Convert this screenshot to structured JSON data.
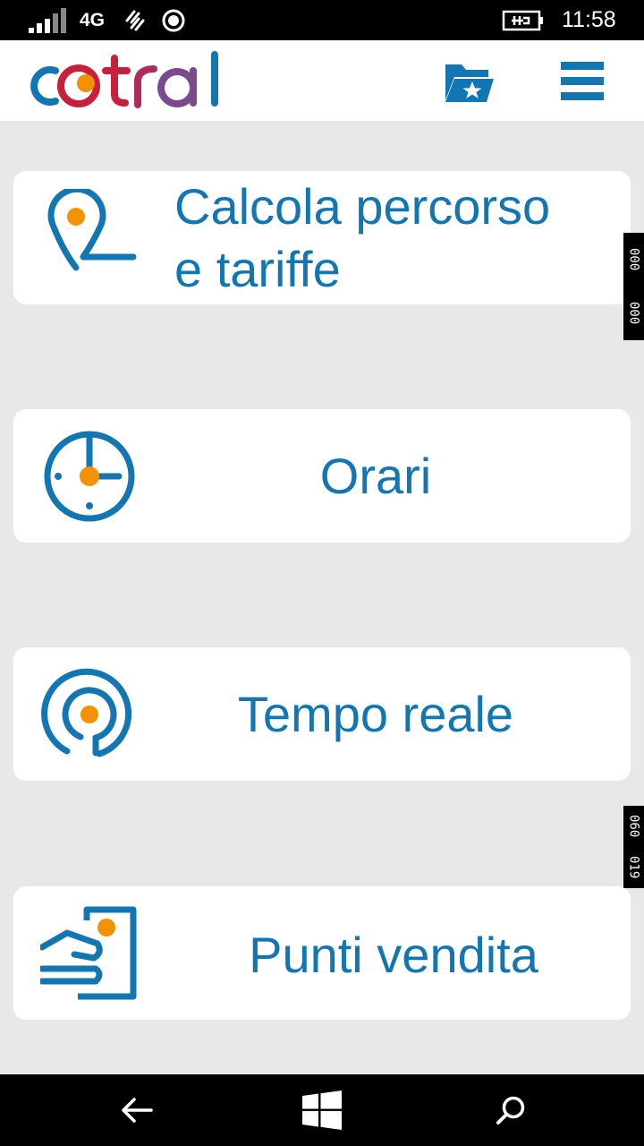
{
  "status_bar": {
    "network": "4G",
    "time": "11:58",
    "icons": [
      "signal-icon",
      "data-sync-icon",
      "location-icon",
      "battery-charging-icon"
    ]
  },
  "header": {
    "logo_text": "cotral",
    "logo_colors": {
      "blue": "#1276b3",
      "red": "#c8203c",
      "orange": "#f39200"
    },
    "favorites_icon": "folder-star-icon",
    "menu_icon": "hamburger-menu-icon"
  },
  "menu": {
    "items": [
      {
        "line1": "Calcola percorso",
        "line2": "e tariffe",
        "icon": "route-pin-icon"
      },
      {
        "label": "Orari",
        "icon": "clock-icon"
      },
      {
        "label": "Tempo reale",
        "icon": "realtime-target-icon"
      },
      {
        "label": "Punti vendita",
        "icon": "ticket-office-icon"
      }
    ]
  },
  "side_tags": [
    {
      "top": "000",
      "bottom": "000"
    },
    {
      "top": "060",
      "bottom": "019"
    }
  ],
  "nav_bar": {
    "icons": [
      "back-arrow-icon",
      "windows-start-icon",
      "search-icon"
    ]
  },
  "colors": {
    "accent": "#1276b3",
    "dot": "#f39200",
    "background": "#e8e8e8"
  }
}
